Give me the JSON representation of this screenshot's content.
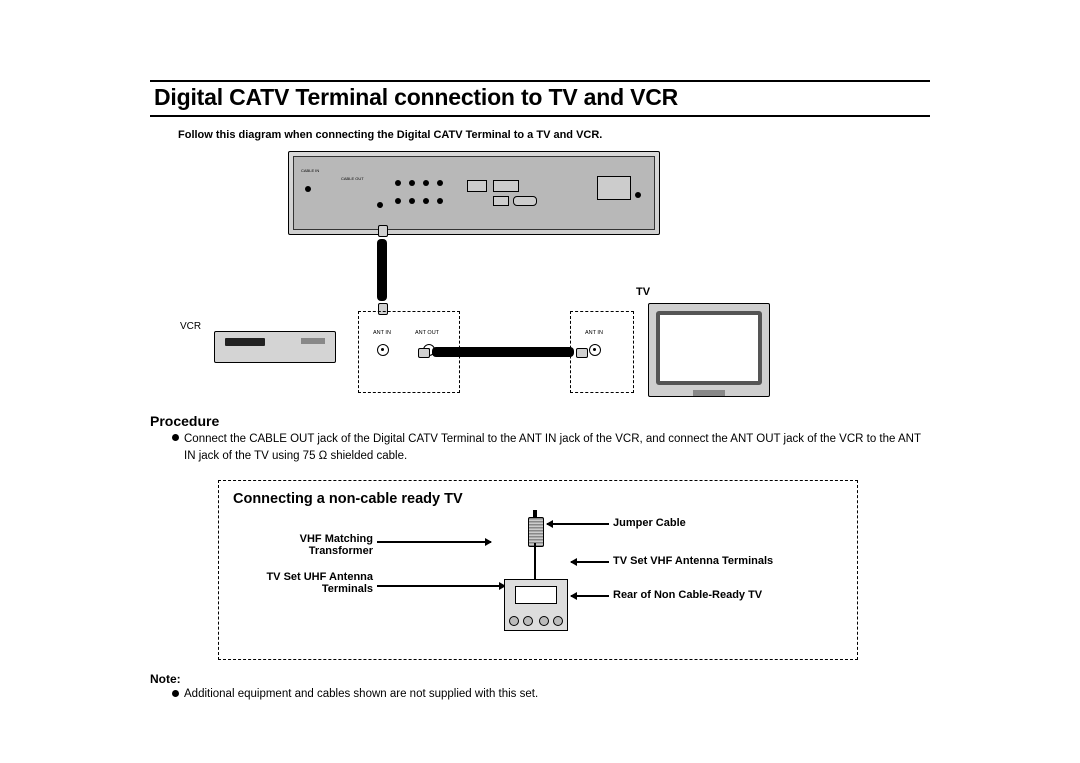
{
  "title": "Digital CATV Terminal connection to TV and VCR",
  "intro": "Follow this diagram when connecting the Digital CATV Terminal to a TV and VCR.",
  "labels": {
    "tv": "TV",
    "vcr": "VCR",
    "ant_in": "ANT IN",
    "ant_out": "ANT OUT",
    "ant_in2": "ANT IN"
  },
  "procedure": {
    "heading": "Procedure",
    "text": "Connect the CABLE OUT jack of the Digital CATV Terminal to the ANT IN jack of the VCR, and connect the ANT OUT jack of the VCR to the ANT IN jack of the TV using 75 Ω shielded cable."
  },
  "panel": {
    "heading": "Connecting a non-cable ready TV",
    "callouts": {
      "jumper": "Jumper Cable",
      "vhf_match": "VHF Matching Transformer",
      "uhf_terms": "TV Set UHF Antenna Terminals",
      "vhf_terms": "TV Set VHF Antenna Terminals",
      "rear_tv": "Rear of Non Cable-Ready TV"
    }
  },
  "note": {
    "heading": "Note:",
    "text": "Additional equipment and cables shown are not supplied with this set."
  }
}
